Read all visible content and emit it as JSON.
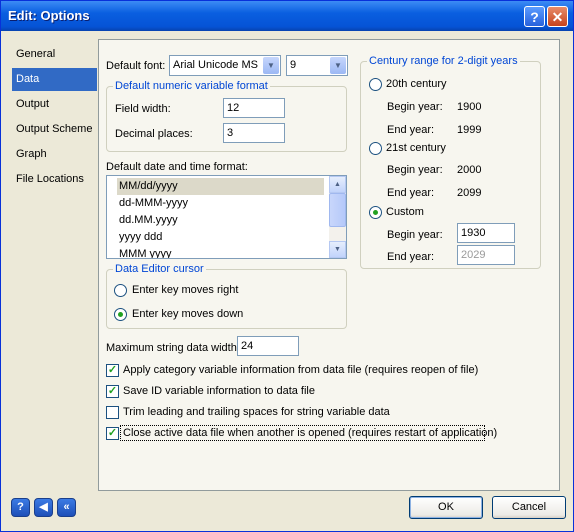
{
  "window": {
    "title": "Edit: Options",
    "help_label": "?",
    "close_label": "✕"
  },
  "tabs": [
    "General",
    "Data",
    "Output",
    "Output Scheme",
    "Graph",
    "File Locations"
  ],
  "selected_tab": "Data",
  "font": {
    "label": "Default font:",
    "value": "Arial Unicode MS",
    "size": "9"
  },
  "numeric_format": {
    "title": "Default numeric variable format",
    "field_width_label": "Field width:",
    "field_width": "12",
    "decimal_places_label": "Decimal places:",
    "decimal_places": "3"
  },
  "date_format": {
    "label": "Default date and time format:",
    "items": [
      "MM/dd/yyyy",
      "dd-MMM-yyyy",
      "dd.MM.yyyy",
      "yyyy ddd",
      "MMM yyyy"
    ],
    "selected": "MM/dd/yyyy"
  },
  "cursor": {
    "title": "Data Editor cursor",
    "options": [
      "Enter key moves right",
      "Enter key moves down"
    ],
    "selected": "Enter key moves down"
  },
  "max_string": {
    "label": "Maximum string data width:",
    "value": "24"
  },
  "checkboxes": [
    {
      "label": "Apply category variable information from data file (requires reopen of file)",
      "checked": true
    },
    {
      "label": "Save ID variable information to data file",
      "checked": true
    },
    {
      "label": "Trim leading and trailing spaces for string variable data",
      "checked": false
    },
    {
      "label": "Close active data file when another is opened (requires restart of application)",
      "checked": true
    }
  ],
  "century": {
    "title": "Century range for 2-digit years",
    "c20": {
      "label": "20th century",
      "begin_label": "Begin year:",
      "begin": "1900",
      "end_label": "End year:",
      "end": "1999"
    },
    "c21": {
      "label": "21st century",
      "begin_label": "Begin year:",
      "begin": "2000",
      "end_label": "End year:",
      "end": "2099"
    },
    "custom": {
      "label": "Custom",
      "begin_label": "Begin year:",
      "begin": "1930",
      "end_label": "End year:",
      "end": "2029"
    },
    "selected": "Custom"
  },
  "buttons": {
    "ok": "OK",
    "cancel": "Cancel"
  },
  "nav_icons": [
    "help-icon",
    "back-icon",
    "first-icon"
  ]
}
